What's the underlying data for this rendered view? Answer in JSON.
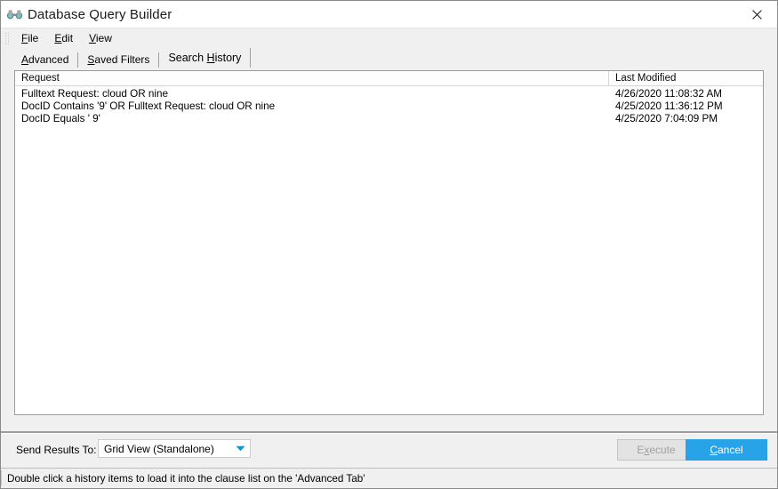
{
  "window": {
    "title": "Database Query Builder",
    "icon": "binoculars-icon",
    "close_label": "✕"
  },
  "menubar": {
    "items": [
      {
        "label": "File",
        "accel": "F"
      },
      {
        "label": "Edit",
        "accel": "E"
      },
      {
        "label": "View",
        "accel": "V"
      }
    ]
  },
  "tabs": [
    {
      "label": "Advanced",
      "accel": "A",
      "active": false
    },
    {
      "label": "Saved Filters",
      "accel": "S",
      "active": false
    },
    {
      "label": "Search History",
      "accel": "H",
      "active": true
    }
  ],
  "list": {
    "columns": [
      "Request",
      "Last Modified"
    ],
    "rows": [
      {
        "request": "Fulltext Request: cloud OR nine",
        "modified": "4/26/2020 11:08:32 AM"
      },
      {
        "request": "DocID Contains '9'  OR Fulltext Request: cloud OR nine",
        "modified": "4/25/2020 11:36:12 PM"
      },
      {
        "request": "DocID Equals ' 9'",
        "modified": "4/25/2020 7:04:09 PM"
      }
    ]
  },
  "bottom": {
    "send_results_label": "Send Results To:",
    "send_results_value": "Grid View (Standalone)",
    "send_results_options": [
      "Grid View (Standalone)"
    ],
    "execute_label": "Execute",
    "execute_accel": "x",
    "execute_enabled": false,
    "cancel_label": "Cancel",
    "cancel_accel": "C"
  },
  "statusbar": {
    "text": "Double click a history items to load it into the clause list on the 'Advanced Tab'"
  },
  "colors": {
    "accent_blue": "#29a3e8",
    "window_bg": "#f0f0f0",
    "list_bg": "#ffffff"
  }
}
